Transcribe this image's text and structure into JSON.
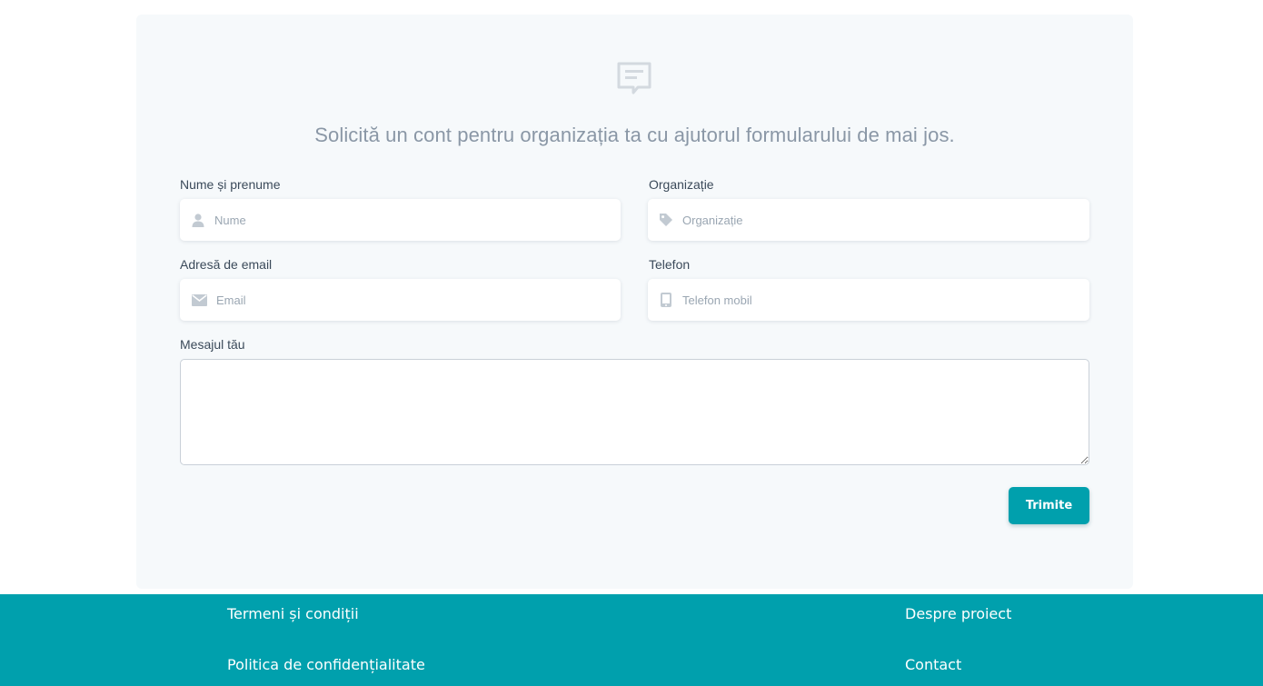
{
  "form": {
    "intro": "Solicită un cont pentru organizația ta cu ajutorul formularului de mai jos.",
    "name": {
      "label": "Nume și prenume",
      "placeholder": "Nume",
      "icon": "user-icon"
    },
    "organization": {
      "label": "Organizație",
      "placeholder": "Organizație",
      "icon": "tag-icon"
    },
    "email": {
      "label": "Adresă de email",
      "placeholder": "Email",
      "icon": "envelope-icon"
    },
    "phone": {
      "label": "Telefon",
      "placeholder": "Telefon mobil",
      "icon": "mobile-phone-icon"
    },
    "message": {
      "label": "Mesajul tău",
      "placeholder": ""
    },
    "submit_label": "Trimite",
    "header_icon": "chat-bubble-icon"
  },
  "footer": {
    "links_left": [
      "Termeni și condiții",
      "Politica de confidențialitate"
    ],
    "links_right": [
      "Despre proiect",
      "Contact"
    ]
  },
  "colors": {
    "accent": "#00a0ad",
    "card_background": "#f6f9fb",
    "icon_gray": "#c2cad2",
    "label_text": "#3b4a5a",
    "intro_text": "#8a97a6"
  }
}
